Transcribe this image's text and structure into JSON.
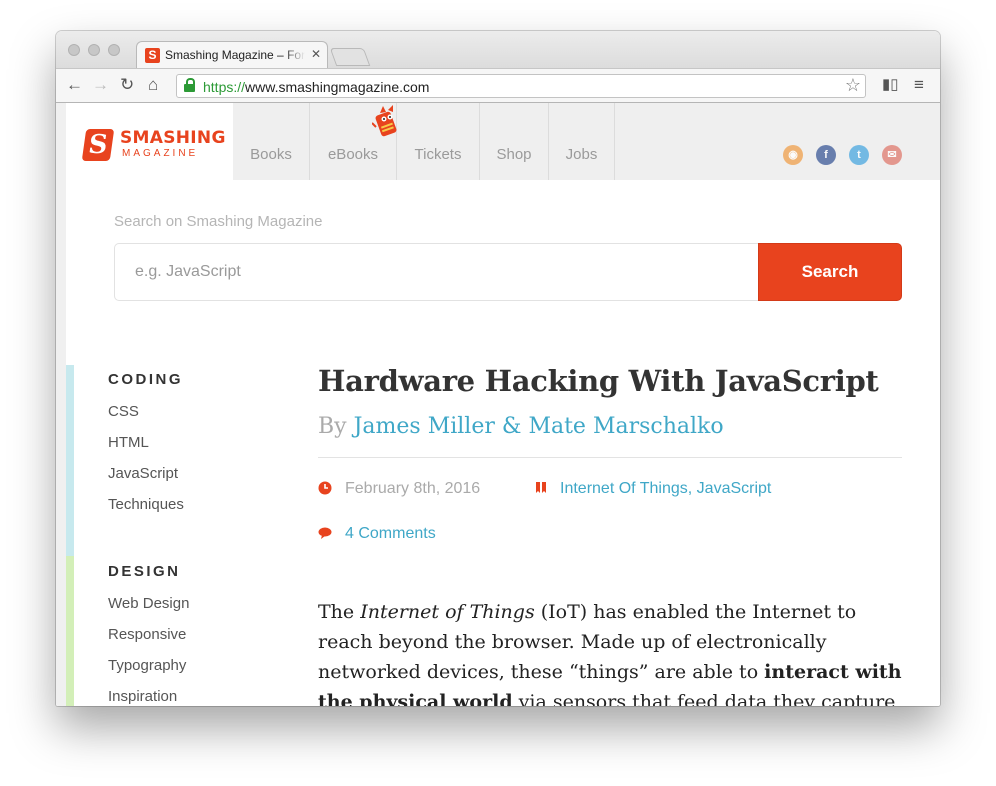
{
  "browser": {
    "tab_title": "Smashing Magazine – For Professional Web Designers",
    "tab_favicon": "S",
    "url_scheme": "https://",
    "url_rest": "www.smashingmagazine.com"
  },
  "header": {
    "logo_main": "SMASHING",
    "logo_sub": "MAGAZINE",
    "nav": [
      "Books",
      "eBooks",
      "Tickets",
      "Shop",
      "Jobs"
    ],
    "social_icons": [
      "rss-icon",
      "facebook-icon",
      "twitter-icon",
      "email-icon"
    ],
    "social_colors": [
      "#f0a04b",
      "#3b5998",
      "#4aa8e0",
      "#e07a6e"
    ]
  },
  "search": {
    "label": "Search on Smashing Magazine",
    "placeholder": "e.g. JavaScript",
    "button": "Search"
  },
  "sidebar": {
    "categories": [
      {
        "title": "CODING",
        "color": "#c7e9ee",
        "links": [
          "CSS",
          "HTML",
          "JavaScript",
          "Techniques"
        ]
      },
      {
        "title": "DESIGN",
        "color": "#d3efb8",
        "links": [
          "Web Design",
          "Responsive",
          "Typography",
          "Inspiration"
        ]
      }
    ]
  },
  "article": {
    "title": "Hardware Hacking With JavaScript",
    "by": "By",
    "authors": "James Miller & Mate Marschalko",
    "date": "February 8th, 2016",
    "tags": "Internet Of Things, JavaScript",
    "comments": "4 Comments",
    "body": {
      "p1_a": "The ",
      "p1_em": "Internet of Things",
      "p1_b": " (IoT) has enabled the Internet to reach beyond the browser. Made up of electronically networked devices, these “things” are able to ",
      "p1_strong": "interact with the physical world",
      "p1_c": " via sensors that feed data they capture back"
    }
  },
  "colors": {
    "accent": "#e8431e",
    "link": "#3fa7c7"
  }
}
